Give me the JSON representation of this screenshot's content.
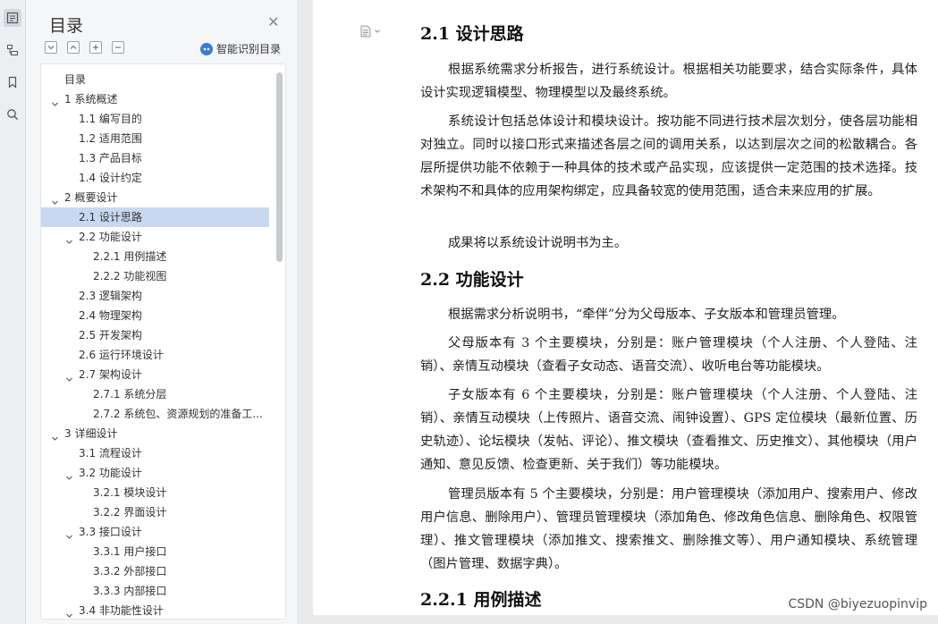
{
  "sidebar": {
    "title": "目录",
    "smart_label": "智能识别目录",
    "items": [
      {
        "label": "目录",
        "level": 0,
        "caret": false
      },
      {
        "label": "1 系统概述",
        "level": 0,
        "caret": true
      },
      {
        "label": "1.1 编写目的",
        "level": 1,
        "caret": false
      },
      {
        "label": "1.2 适用范围",
        "level": 1,
        "caret": false
      },
      {
        "label": "1.3 产品目标",
        "level": 1,
        "caret": false
      },
      {
        "label": "1.4 设计约定",
        "level": 1,
        "caret": false
      },
      {
        "label": "2 概要设计",
        "level": 0,
        "caret": true
      },
      {
        "label": "2.1 设计思路",
        "level": 1,
        "caret": false,
        "active": true
      },
      {
        "label": "2.2 功能设计",
        "level": 1,
        "caret": true
      },
      {
        "label": "2.2.1 用例描述",
        "level": 2,
        "caret": false
      },
      {
        "label": "2.2.2 功能视图",
        "level": 2,
        "caret": false
      },
      {
        "label": "2.3 逻辑架构",
        "level": 1,
        "caret": false
      },
      {
        "label": "2.4 物理架构",
        "level": 1,
        "caret": false
      },
      {
        "label": "2.5 开发架构",
        "level": 1,
        "caret": false
      },
      {
        "label": "2.6 运行环境设计",
        "level": 1,
        "caret": false
      },
      {
        "label": "2.7 架构设计",
        "level": 1,
        "caret": true
      },
      {
        "label": "2.7.1 系统分层",
        "level": 2,
        "caret": false
      },
      {
        "label": "2.7.2 系统包、资源规划的准备工...",
        "level": 2,
        "caret": false
      },
      {
        "label": "3 详细设计",
        "level": 0,
        "caret": true
      },
      {
        "label": "3.1 流程设计",
        "level": 1,
        "caret": false
      },
      {
        "label": "3.2 功能设计",
        "level": 1,
        "caret": true
      },
      {
        "label": "3.2.1 模块设计",
        "level": 2,
        "caret": false
      },
      {
        "label": "3.2.2 界面设计",
        "level": 2,
        "caret": false
      },
      {
        "label": "3.3 接口设计",
        "level": 1,
        "caret": true
      },
      {
        "label": "3.3.1 用户接口",
        "level": 2,
        "caret": false
      },
      {
        "label": "3.3.2 外部接口",
        "level": 2,
        "caret": false
      },
      {
        "label": "3.3.3 内部接口",
        "level": 2,
        "caret": false
      },
      {
        "label": "3.4 非功能性设计",
        "level": 1,
        "caret": true
      }
    ]
  },
  "document": {
    "h_21": "2.1 设计思路",
    "p1": "根据系统需求分析报告，进行系统设计。根据相关功能要求，结合实际条件，具体设计实现逻辑模型、物理模型以及最终系统。",
    "p2": "系统设计包括总体设计和模块设计。按功能不同进行技术层次划分，使各层功能相对独立。同时以接口形式来描述各层之间的调用关系，以达到层次之间的松散耦合。各层所提供功能不依赖于一种具体的技术或产品实现，应该提供一定范围的技术选择。技术架构不和具体的应用架构绑定，应具备较宽的使用范围，适合未来应用的扩展。",
    "p3": "成果将以系统设计说明书为主。",
    "h_22": "2.2 功能设计",
    "p4": "根据需求分析说明书，“牵伴”分为父母版本、子女版本和管理员管理。",
    "p5": "父母版本有 3 个主要模块，分别是：账户管理模块（个人注册、个人登陆、注销）、亲情互动模块（查看子女动态、语音交流）、收听电台等功能模块。",
    "p6": "子女版本有 6 个主要模块，分别是：账户管理模块（个人注册、个人登陆、注销）、亲情互动模块（上传照片、语音交流、闹钟设置）、GPS 定位模块（最新位置、历史轨迹）、论坛模块（发帖、评论）、推文模块（查看推文、历史推文）、其他模块（用户通知、意见反馈、检查更新、关于我们）等功能模块。",
    "p7": "管理员版本有 5 个主要模块，分别是：用户管理模块（添加用户、搜索用户、修改用户信息、删除用户）、管理员管理模块（添加角色、修改角色信息、删除角色、权限管理）、推文管理模块（添加推文、搜索推文、删除推文等）、用户通知模块、系统管理（图片管理、数据字典）。",
    "h_221": "2.2.1 用例描述"
  },
  "watermark": "CSDN @biyezuopinvip",
  "colors": {
    "accent": "#3a7bd5",
    "active_item": "#c9d8f1"
  }
}
